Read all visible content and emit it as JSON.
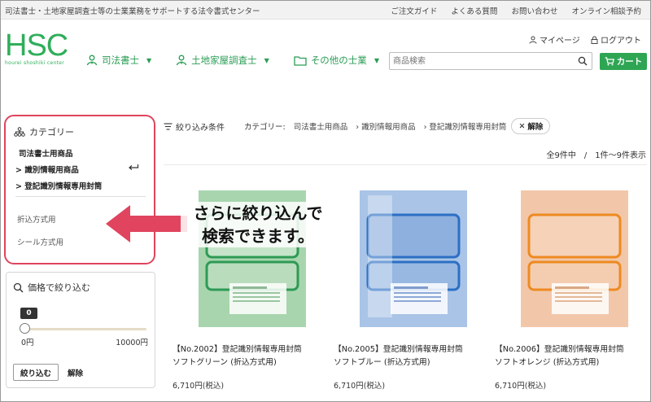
{
  "topbar": {
    "tagline": "司法書士・土地家屋調査士等の士業業務をサポートする法令書式センター",
    "links": [
      "ご注文ガイド",
      "よくある質問",
      "お問い合わせ",
      "オンライン相談予約"
    ]
  },
  "logo": {
    "mark": "HSC",
    "sub": "hourei shoshiki center"
  },
  "account": {
    "mypage": "マイページ",
    "logout": "ログアウト"
  },
  "nav": [
    {
      "label": "司法書士",
      "icon": "person-icon"
    },
    {
      "label": "土地家屋調査士",
      "icon": "person-icon"
    },
    {
      "label": "その他の士業",
      "icon": "folder-icon"
    }
  ],
  "search": {
    "placeholder": "商品検索"
  },
  "cart": {
    "label": "カート"
  },
  "category": {
    "title": "カテゴリー",
    "items": [
      "司法書士用商品",
      "識別情報用商品",
      "登記識別情報専用封筒"
    ],
    "subitems": [
      "折込方式用",
      "シール方式用"
    ]
  },
  "price": {
    "title": "価格で絞り込む",
    "current": "0",
    "min": "0円",
    "max": "10000円",
    "apply": "絞り込む",
    "clear": "解除"
  },
  "filter": {
    "label": "絞り込み条件",
    "category_lead": "カテゴリー:",
    "crumbs": [
      "司法書士用商品",
      "識別情報用商品",
      "登記識別情報専用封筒"
    ],
    "clear_chip": "解除"
  },
  "results": {
    "summary": "全9件中　/　1件～9件表示"
  },
  "callout": {
    "line1": "さらに絞り込んで",
    "line2": "検索できます。"
  },
  "products": [
    {
      "name1": "【No.2002】登記識別情報専用封筒",
      "name2": "ソフトグリーン (折込方式用)",
      "price": "6,710円(税込)",
      "color": "#a8d5ae",
      "window_color": "#2e9a55"
    },
    {
      "name1": "【No.2005】登記識別情報専用封筒",
      "name2": "ソフトブルー (折込方式用)",
      "price": "6,710円(税込)",
      "color": "#a9c4e6",
      "window_color": "#2c6fc4"
    },
    {
      "name1": "【No.2006】登記識別情報専用封筒",
      "name2": "ソフトオレンジ (折込方式用)",
      "price": "6,710円(税込)",
      "color": "#f2c7a9",
      "window_color": "#ee8a22"
    }
  ],
  "colors": {
    "brand_green": "#2fae5b",
    "highlight_red": "#e0445e"
  }
}
